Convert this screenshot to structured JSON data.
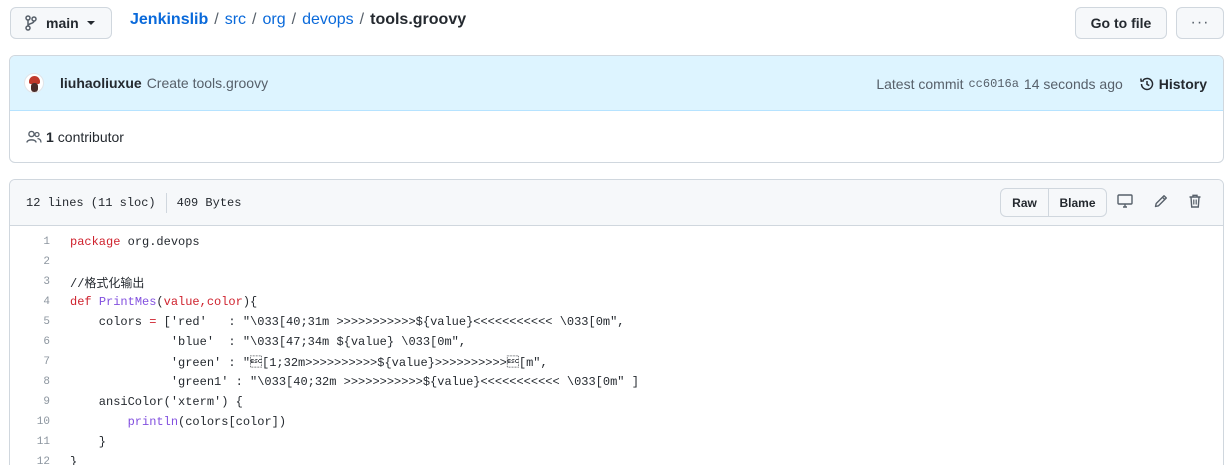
{
  "topbar": {
    "branch": "main",
    "crumbs": {
      "repo": "Jenkinslib",
      "p1": "src",
      "p2": "org",
      "p3": "devops",
      "file": "tools.groovy",
      "sep": "/"
    },
    "goto_label": "Go to file",
    "more_label": "···"
  },
  "commit": {
    "author": "liuhaoliuxue",
    "message": "Create tools.groovy",
    "latest_label": "Latest commit",
    "sha": "cc6016a",
    "time": "14 seconds ago",
    "history_label": "History",
    "contributors_count": "1",
    "contributors_label": "contributor"
  },
  "file": {
    "lines_info": "12 lines (11 sloc)",
    "size": "409 Bytes",
    "raw_label": "Raw",
    "blame_label": "Blame"
  },
  "code": {
    "l1_kw": "package",
    "l1_rest": " org.devops",
    "l3": "//格式化输出",
    "l4_kw": "def",
    "l4_fn": "PrintMes",
    "l4_p1": "(",
    "l4_args": "value,color",
    "l4_p2": "){",
    "l5_a": "    colors ",
    "l5_eq": "=",
    "l5_b": " ['red'   : \"\\033[40;31m >>>>>>>>>>>${value}<<<<<<<<<<< \\033[0m\",",
    "l6": "              'blue'  : \"\\033[47;34m ${value} \\033[0m\",",
    "l7": "              'green' : \"\u001b[1;32m>>>>>>>>>>${value}>>>>>>>>>>\u001b[m\",",
    "l8": "              'green1' : \"\\033[40;32m >>>>>>>>>>>${value}<<<<<<<<<<< \\033[0m\" ]",
    "l9": "    ansiColor('xterm') {",
    "l10_a": "        ",
    "l10_fn": "println",
    "l10_b": "(colors[color])",
    "l11": "    }",
    "l12": "}"
  },
  "line_numbers": [
    "1",
    "2",
    "3",
    "4",
    "5",
    "6",
    "7",
    "8",
    "9",
    "10",
    "11",
    "12"
  ]
}
